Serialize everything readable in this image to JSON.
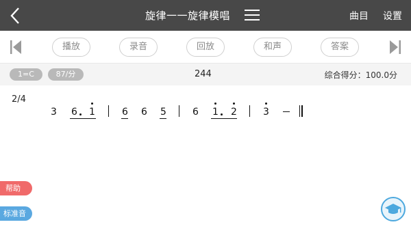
{
  "header": {
    "title": "旋律一一旋律模唱",
    "links": [
      "曲目",
      "设置"
    ]
  },
  "toolbar": {
    "buttons": [
      "播放",
      "录音",
      "回放",
      "和声",
      "答案"
    ]
  },
  "info": {
    "key": "1=C",
    "tempo": "87/分",
    "center_number": "244",
    "score": "综合得分：100.0分"
  },
  "notation": {
    "time_signature": "2/4",
    "notes": {
      "n1": "3",
      "n2": "6",
      "n3": "1",
      "n4": "6",
      "n5": "6",
      "n6": "5",
      "n7": "6",
      "n8": "1",
      "n9": "2",
      "n10": "3",
      "dash": "–"
    }
  },
  "side": {
    "help": "帮助",
    "standard": "标准音"
  },
  "colors": {
    "header_bg": "#484848",
    "help_btn": "#f06a6a",
    "standard_btn": "#5aa8e0",
    "fab_accent": "#4ca8de"
  },
  "icons": [
    "back-arrow-icon",
    "menu-icon",
    "skip-previous-icon",
    "skip-next-icon",
    "graduation-cap-icon"
  ]
}
